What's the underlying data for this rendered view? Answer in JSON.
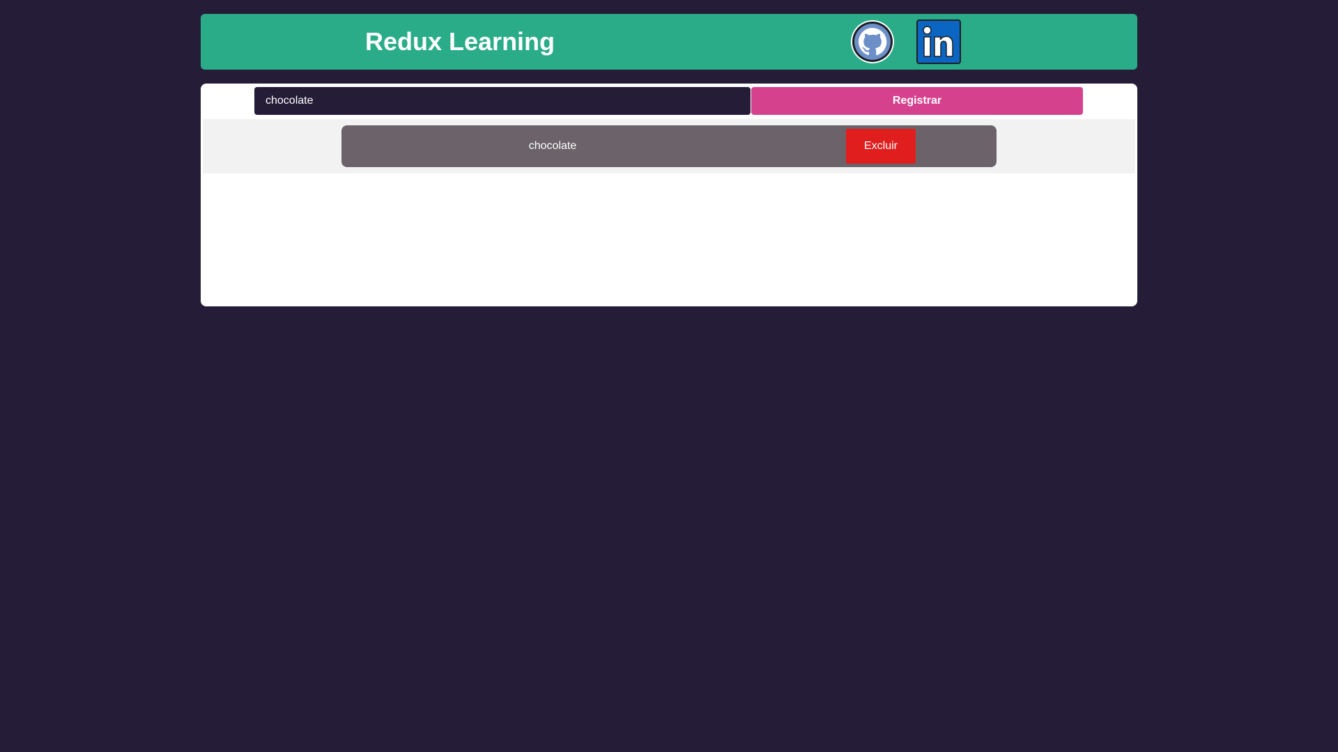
{
  "header": {
    "title": "Redux Learning",
    "links": [
      {
        "icon": "github-icon"
      },
      {
        "icon": "linkedin-icon"
      }
    ]
  },
  "form": {
    "input_value": "chocolate",
    "submit_label": "Registrar"
  },
  "list": {
    "items": [
      {
        "text": "chocolate",
        "delete_label": "Excluir"
      }
    ]
  },
  "colors": {
    "background": "#251d38",
    "header": "#2aac89",
    "submit": "#d6418d",
    "item": "#6b6369",
    "delete": "#e01e1e"
  }
}
